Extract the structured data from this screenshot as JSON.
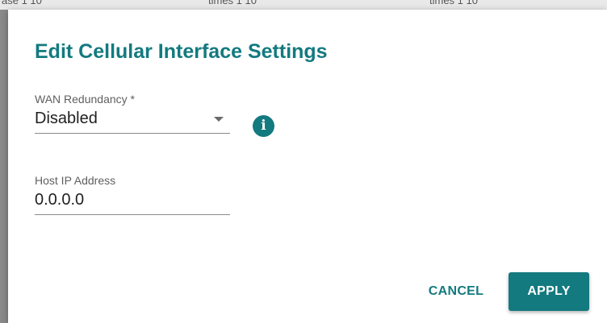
{
  "background": {
    "fragments": [
      "ase 1 10",
      "times 1 10",
      "times 1 10"
    ]
  },
  "dialog": {
    "title": "Edit Cellular Interface Settings",
    "wan_redundancy": {
      "label": "WAN Redundancy *",
      "value": "Disabled",
      "icon": "info-icon"
    },
    "host_ip": {
      "label": "Host IP Address",
      "value": "0.0.0.0"
    },
    "buttons": {
      "cancel": "CANCEL",
      "apply": "APPLY"
    }
  },
  "colors": {
    "accent": "#137a7f",
    "apply_text": "#ffffff"
  }
}
